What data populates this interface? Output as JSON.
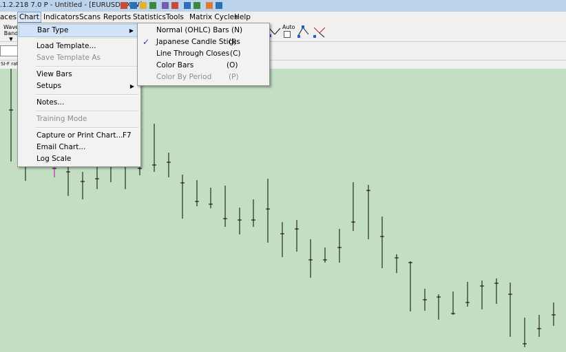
{
  "window": {
    "title": ".1.2.218 7.0 P - Untitled - [EURUSD=X-W]"
  },
  "menubar": {
    "items": [
      {
        "label": "aces"
      },
      {
        "label": "Chart"
      },
      {
        "label": "Indicators"
      },
      {
        "label": "Scans"
      },
      {
        "label": "Reports"
      },
      {
        "label": "Statistics"
      },
      {
        "label": "Tools"
      },
      {
        "label": "Matrix Cycles"
      },
      {
        "label": "Help"
      }
    ]
  },
  "toolbar": {
    "wave_label": "Wave",
    "band_label": "Band",
    "auto_label": "Auto"
  },
  "status": {
    "sig_text": "SI-F rat"
  },
  "chart_menu": {
    "items": [
      {
        "label": "Bar Type"
      },
      {
        "label": "Load Template..."
      },
      {
        "label": "Save Template As"
      },
      {
        "label": "View Bars"
      },
      {
        "label": "Setups"
      },
      {
        "label": "Notes..."
      },
      {
        "label": "Training Mode"
      },
      {
        "label": "Capture or Print Chart...",
        "shortcut": "F7"
      },
      {
        "label": "Email Chart..."
      },
      {
        "label": "Log Scale"
      }
    ]
  },
  "bar_type_menu": {
    "items": [
      {
        "label": "Normal (OHLC) Bars",
        "shortcut": "(N)"
      },
      {
        "label": "Japanese Candle Sticks",
        "shortcut": "(J)",
        "checked": true
      },
      {
        "label": "Line Through Closes",
        "shortcut": "(C)"
      },
      {
        "label": "Color Bars",
        "shortcut": "(O)"
      },
      {
        "label": "Color By Period",
        "shortcut": "(P)"
      }
    ]
  },
  "colors": {
    "chart_bg": "#c3dec3",
    "bar": "#000000",
    "highlight": "#d2e3f7"
  }
}
